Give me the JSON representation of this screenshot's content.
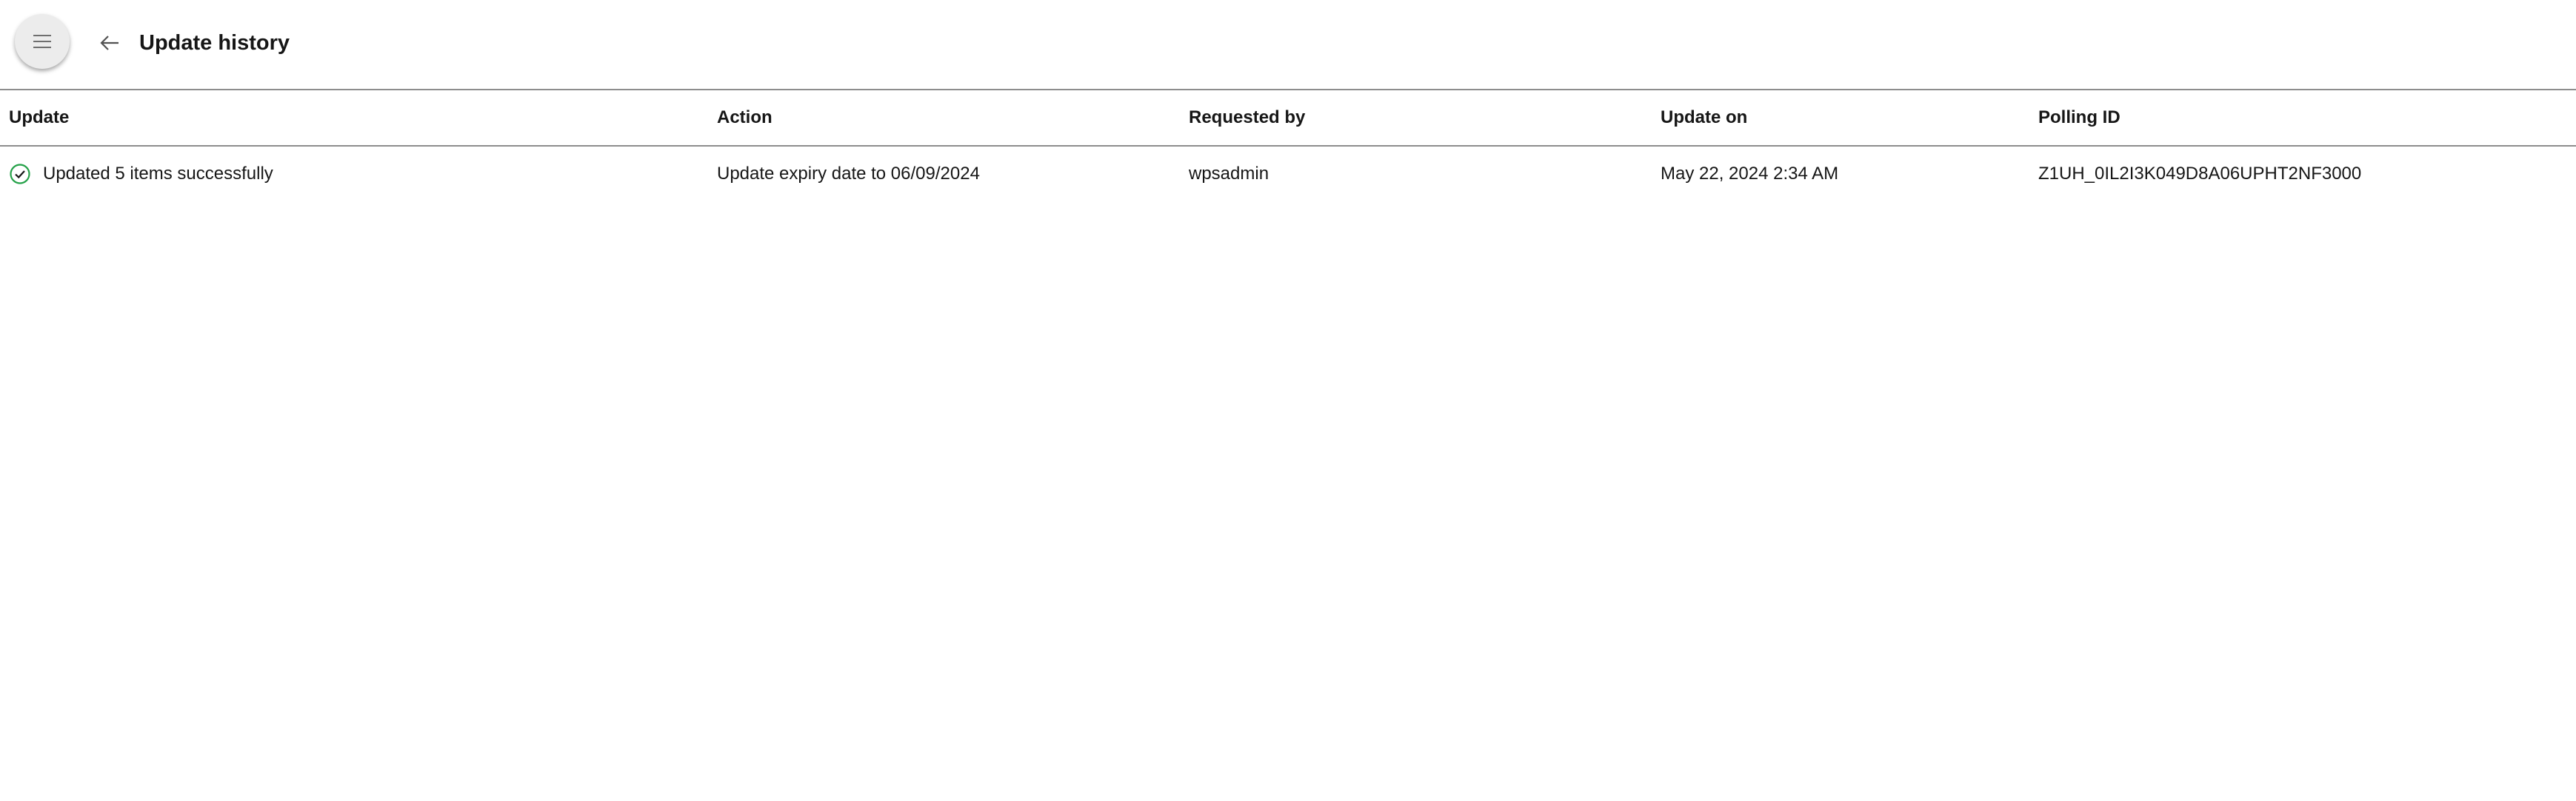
{
  "header": {
    "menu_icon": "menu-icon",
    "back_icon": "arrow-left-icon",
    "title": "Update history"
  },
  "table": {
    "columns": [
      "Update",
      "Action",
      "Requested by",
      "Update on",
      "Polling ID"
    ],
    "rows": [
      {
        "status_icon": "check-circle-icon",
        "status_color": "#24a148",
        "update": "Updated 5 items successfully",
        "action": "Update expiry date to 06/09/2024",
        "requested_by": "wpsadmin",
        "update_on": "May 22, 2024 2:34 AM",
        "polling_id": "Z1UH_0IL2I3K049D8A06UPHT2NF3000"
      }
    ]
  },
  "colors": {
    "divider": "#8d8d8d",
    "success": "#24a148",
    "menu_button_bg": "#ececec"
  }
}
